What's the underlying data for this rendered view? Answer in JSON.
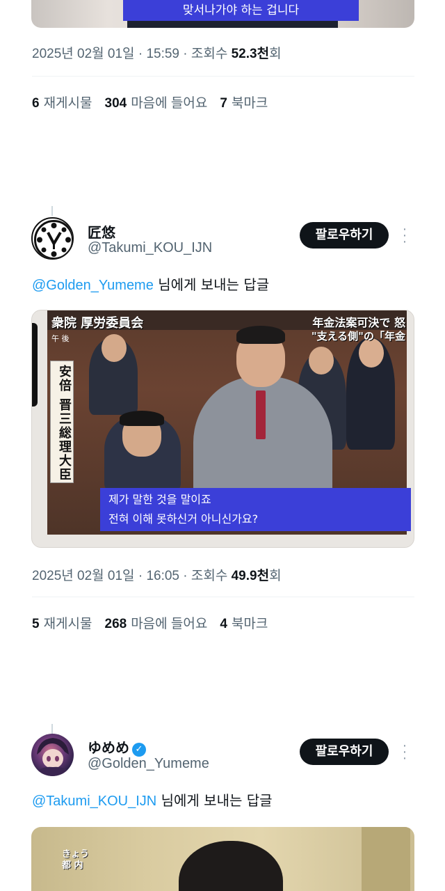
{
  "top_tweet": {
    "image_caption": "맞서나가야 하는 겁니다",
    "meta": {
      "date": "2025년 02월 01일",
      "sep": " · ",
      "time": "15:59",
      "views_label": "조회수",
      "views_value": "52.3천",
      "views_suffix": "회"
    },
    "stats": {
      "reposts_count": "6",
      "reposts_label": "재게시물",
      "likes_count": "304",
      "likes_label": "마음에 들어요",
      "bookmarks_count": "7",
      "bookmarks_label": "북마크"
    }
  },
  "tweet2": {
    "display_name": "匠悠",
    "handle": "@Takumi_KOU_IJN",
    "follow_label": "팔로우하기",
    "reply_mention": "@Golden_Yumeme",
    "reply_text": " 님에게 보내는 답글",
    "image": {
      "title_left": "衆院 厚労委員会",
      "afternoon": "午 後",
      "title_right": "年金法案可決で 怒",
      "subtitle_right": "\"支える側\"の「年金",
      "name_plate": "安倍 晋三総理大臣",
      "caption_line1": "제가 말한 것을 말이죠",
      "caption_line2": "전혀 이해 못하신거 아니신가요?"
    },
    "meta": {
      "date": "2025년 02월 01일",
      "sep": " · ",
      "time": "16:05",
      "views_label": "조회수",
      "views_value": "49.9천",
      "views_suffix": "회"
    },
    "stats": {
      "reposts_count": "5",
      "reposts_label": "재게시물",
      "likes_count": "268",
      "likes_label": "마음에 들어요",
      "bookmarks_count": "4",
      "bookmarks_label": "북마크"
    }
  },
  "tweet3": {
    "display_name": "ゆめめ",
    "handle": "@Golden_Yumeme",
    "follow_label": "팔로우하기",
    "reply_mention": "@Takumi_KOU_IJN",
    "reply_text": " 님에게 보내는 답글",
    "image": {
      "label_line1": "きょう",
      "label_line2": "都 内"
    }
  },
  "colors": {
    "accent": "#1d9bf0",
    "text": "#0f1419",
    "muted": "#536471",
    "caption_band": "#3b3fd8",
    "button": "#0f1419"
  },
  "icons": {
    "more": "more-vertical-icon",
    "verified": "verified-badge-icon"
  }
}
